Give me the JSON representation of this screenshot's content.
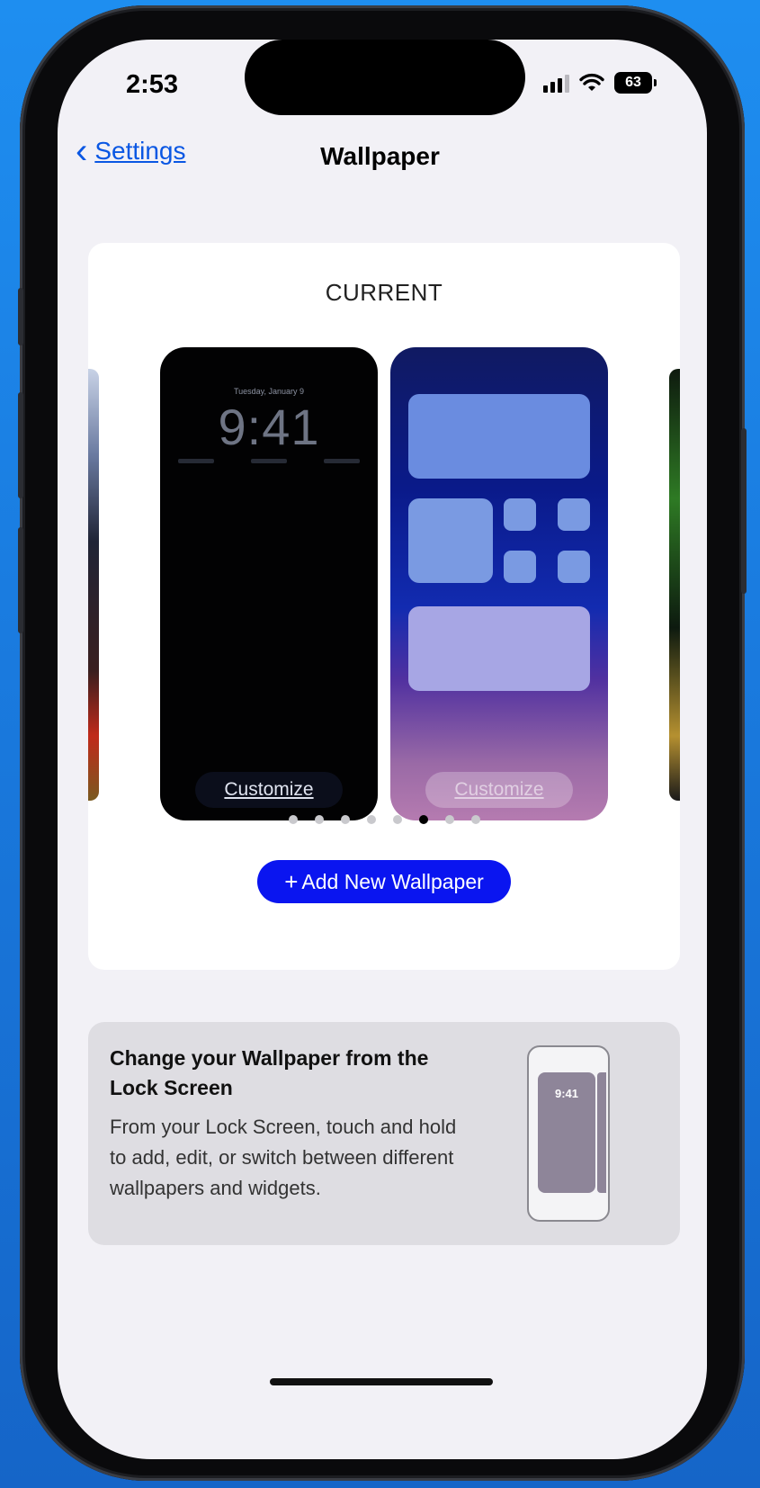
{
  "status_bar": {
    "time": "2:53",
    "battery": "63"
  },
  "nav": {
    "back_label": "Settings",
    "title": "Wallpaper"
  },
  "current": {
    "label": "CURRENT",
    "lock_screen": {
      "date": "Tuesday, January 9",
      "clock": "9:41",
      "customize_label": "Customize"
    },
    "home_screen": {
      "customize_label": "Customize"
    },
    "pages": {
      "count": 8,
      "active_index": 5
    },
    "add_button": {
      "plus": "+",
      "label": "Add New Wallpaper"
    }
  },
  "tip": {
    "title": "Change your Wallpaper from the Lock Screen",
    "body": "From your Lock Screen, touch and hold to add, edit, or switch between different wallpapers and widgets.",
    "illustration_time": "9:41"
  },
  "colors": {
    "accent": "#0a57e3",
    "add_button": "#0a15f0",
    "background": "#f2f1f6"
  }
}
